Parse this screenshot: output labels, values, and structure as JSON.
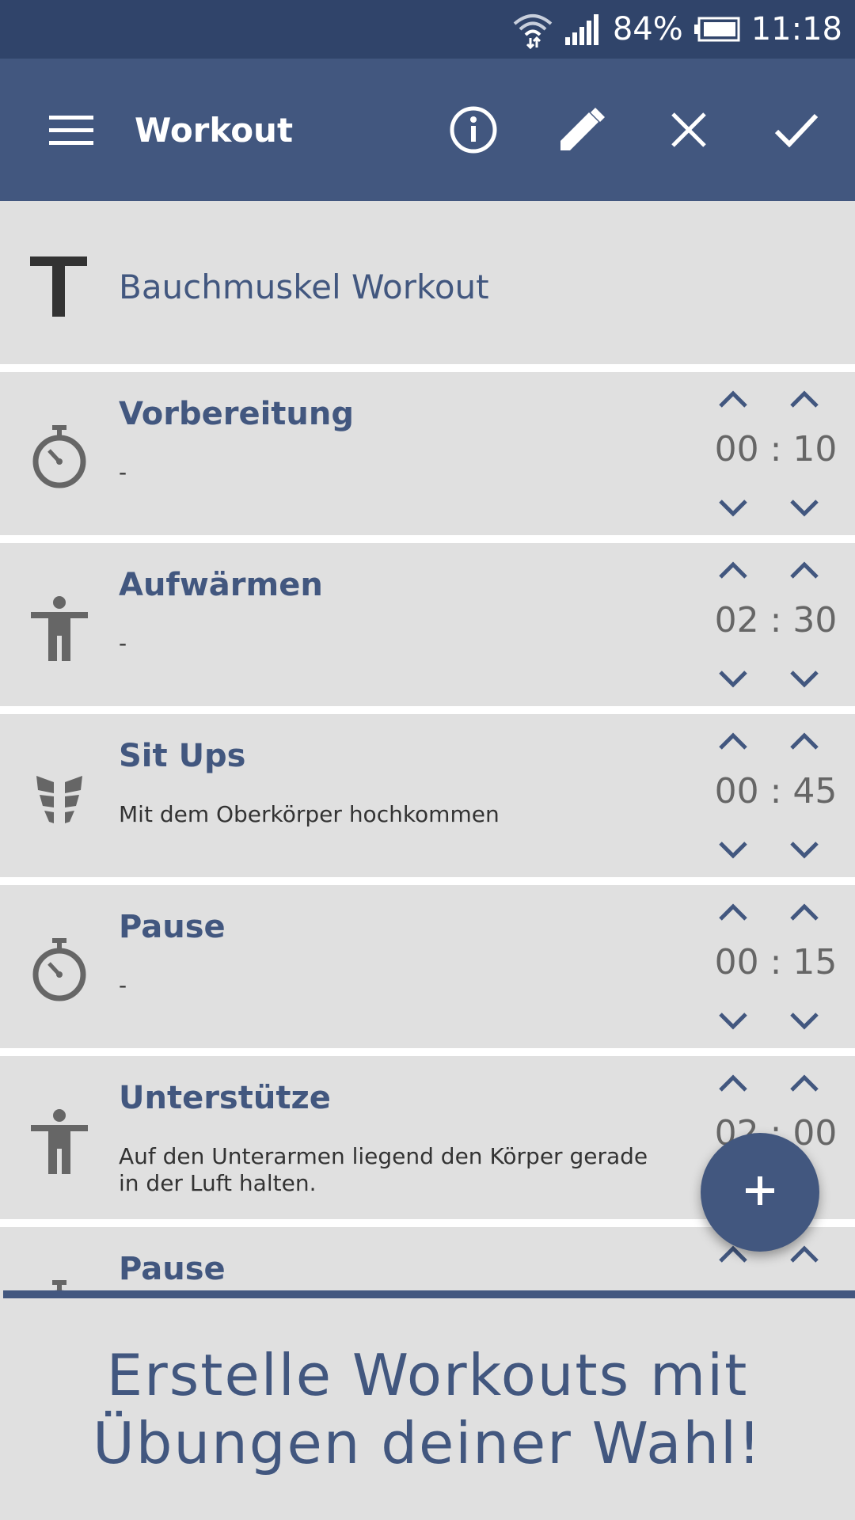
{
  "status_bar": {
    "battery": "84%",
    "time": "11:18",
    "icons": [
      "wifi-icon",
      "signal-icon",
      "battery-icon"
    ]
  },
  "app_bar": {
    "title": "Workout",
    "icons": [
      "menu-icon",
      "info-icon",
      "edit-icon",
      "close-icon",
      "check-icon"
    ]
  },
  "workout": {
    "name": "Bauchmuskel Workout"
  },
  "exercises": [
    {
      "title": "Vorbereitung",
      "description": "-",
      "minutes": "00",
      "seconds": "10",
      "icon": "stopwatch-icon"
    },
    {
      "title": "Aufwärmen",
      "description": "-",
      "minutes": "02",
      "seconds": "30",
      "icon": "person-icon"
    },
    {
      "title": "Sit Ups",
      "description": "Mit dem Oberkörper hochkommen",
      "minutes": "00",
      "seconds": "45",
      "icon": "abs-icon"
    },
    {
      "title": "Pause",
      "description": "-",
      "minutes": "00",
      "seconds": "15",
      "icon": "stopwatch-icon"
    },
    {
      "title": "Unterstütze",
      "description": "Auf den Unterarmen liegend den Körper gerade in der Luft halten.",
      "minutes": "02",
      "seconds": "00",
      "icon": "person-icon"
    },
    {
      "title": "Pause",
      "description": "",
      "minutes": "",
      "seconds": "",
      "icon": "stopwatch-icon"
    }
  ],
  "fab": {
    "icon": "plus-icon"
  },
  "promo": {
    "line1": "Erstelle Workouts mit",
    "line2": "Übungen deiner Wahl!"
  },
  "colors": {
    "primary": "#42577f",
    "status_bar": "#30446a",
    "background": "#e0e0e0"
  }
}
